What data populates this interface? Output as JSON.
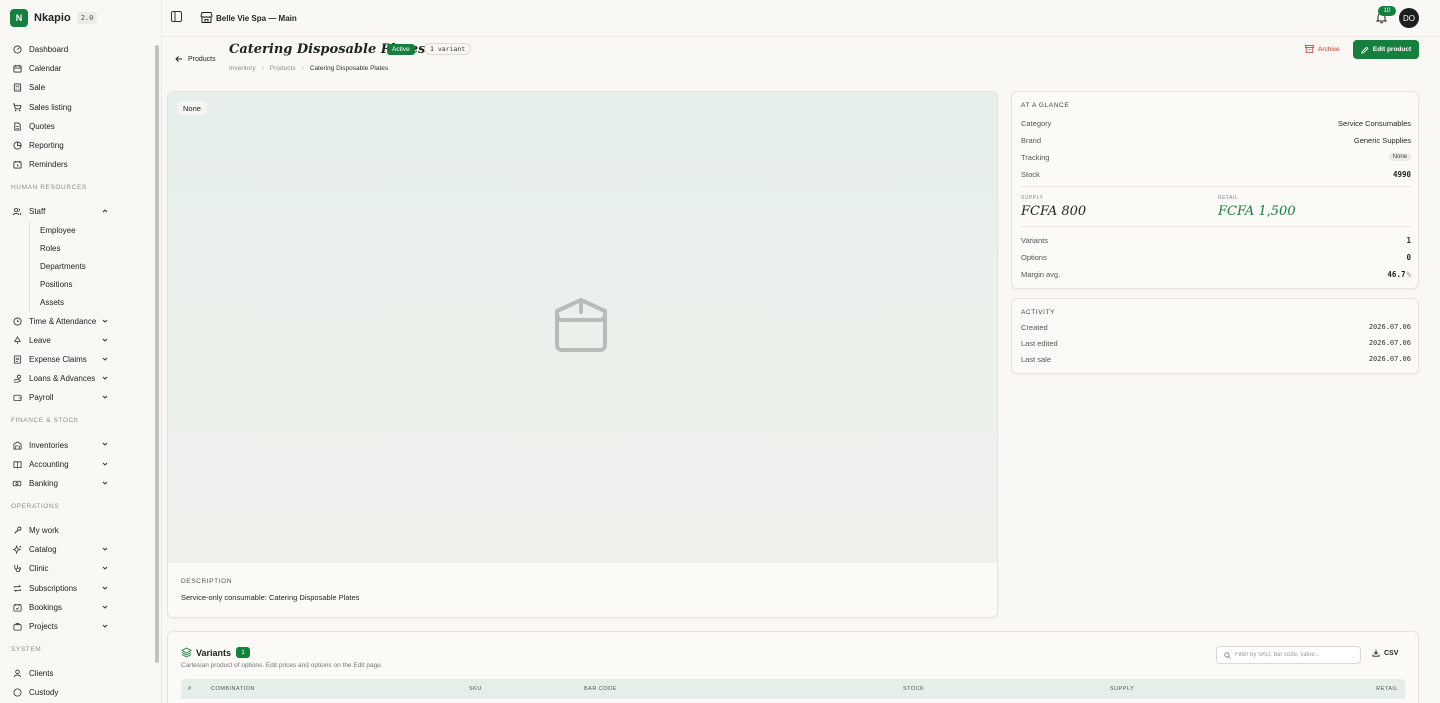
{
  "app": {
    "name": "Nkapio",
    "version": "2.0"
  },
  "sidebar": {
    "main_items": [
      {
        "label": "Dashboard"
      },
      {
        "label": "Calendar"
      },
      {
        "label": "Sale"
      },
      {
        "label": "Sales listing"
      },
      {
        "label": "Quotes"
      },
      {
        "label": "Reporting"
      },
      {
        "label": "Reminders"
      }
    ],
    "sections": {
      "hr": "HUMAN RESOURCES",
      "finance": "FINANCE & STOCK",
      "operations": "OPERATIONS",
      "system": "SYSTEM"
    },
    "staff": {
      "label": "Staff",
      "children": [
        "Employee",
        "Roles",
        "Departments",
        "Positions",
        "Assets"
      ]
    },
    "hr_items": [
      {
        "label": "Time & Attendance"
      },
      {
        "label": "Leave"
      },
      {
        "label": "Expense Claims"
      },
      {
        "label": "Loans & Advances"
      },
      {
        "label": "Payroll"
      }
    ],
    "finance_items": [
      {
        "label": "Inventories"
      },
      {
        "label": "Accounting"
      },
      {
        "label": "Banking"
      }
    ],
    "operations_items": [
      {
        "label": "My work"
      },
      {
        "label": "Catalog"
      },
      {
        "label": "Clinic"
      },
      {
        "label": "Subscriptions"
      },
      {
        "label": "Bookings"
      },
      {
        "label": "Projects"
      }
    ],
    "system_items": [
      {
        "label": "Clients"
      },
      {
        "label": "Custody"
      }
    ]
  },
  "topbar": {
    "store": "Belle Vie Spa — Main",
    "notifications": "10",
    "avatar_initials": "DO"
  },
  "header": {
    "back_label": "Products",
    "title": "Catering Disposable Plates",
    "status": "Active",
    "variant_badge": "1 variant",
    "breadcrumb": [
      "Inventory",
      "Products",
      "Catering Disposable Plates"
    ],
    "archive_label": "Archive",
    "edit_label": "Edit product"
  },
  "image_card": {
    "tag": "None",
    "description_heading": "DESCRIPTION",
    "description": "Service-only consumable: Catering Disposable Plates"
  },
  "glance": {
    "heading": "AT A GLANCE",
    "category_label": "Category",
    "category": "Service Consumables",
    "brand_label": "Brand",
    "brand": "Generic Supplies",
    "tracking_label": "Tracking",
    "tracking": "None",
    "stock_label": "Stock",
    "stock": "4990",
    "supply_label": "SUPPLY",
    "supply": "FCFA 800",
    "retail_label": "RETAIL",
    "retail": "FCFA 1,500",
    "variants_label": "Variants",
    "variants": "1",
    "options_label": "Options",
    "options": "0",
    "margin_label": "Margin avg.",
    "margin": "46.7",
    "margin_unit": "%"
  },
  "activity": {
    "heading": "ACTIVITY",
    "created_label": "Created",
    "created": "2026.07.06",
    "edited_label": "Last edited",
    "edited": "2026.07.06",
    "sale_label": "Last sale",
    "sale": "2026.07.06"
  },
  "variants": {
    "title": "Variants",
    "count": "1",
    "subtitle": "Cartesian product of options. Edit prices and options on the Edit page.",
    "filter_placeholder": "Filter by SKU, bar code, value...",
    "csv_label": "CSV",
    "columns": [
      "#",
      "COMBINATION",
      "SKU",
      "BAR CODE",
      "STOCK",
      "SUPPLY",
      "RETAIL"
    ]
  },
  "colors": {
    "accent": "#15803d",
    "danger": "#c0392b",
    "retail": "#15803d"
  }
}
